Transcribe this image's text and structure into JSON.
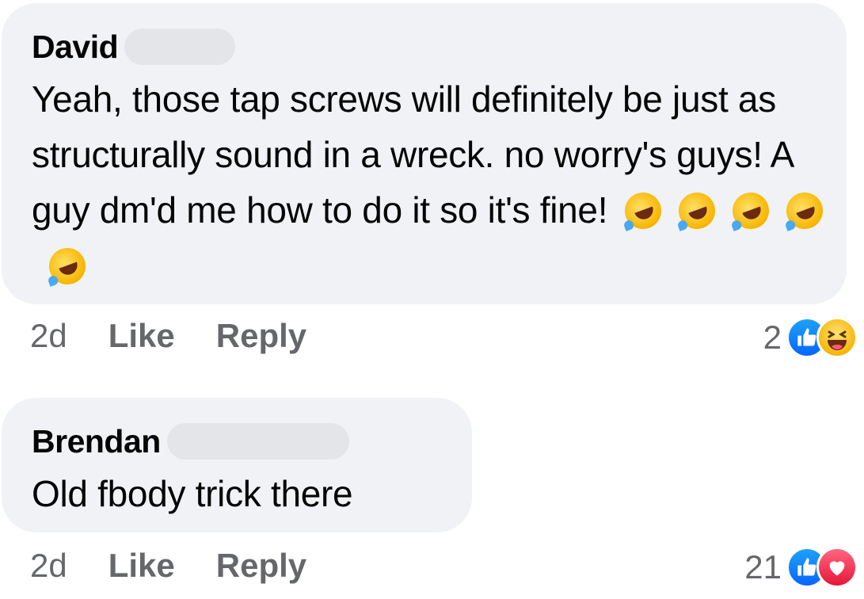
{
  "comments": [
    {
      "author": "David",
      "text": "Yeah, those tap screws will definitely be just as structurally sound in a wreck. no worry's guys! A guy dm'd me how to do it so it's fine!",
      "emojis": [
        "rofl-emoji",
        "rofl-emoji",
        "rofl-emoji",
        "rofl-emoji",
        "rofl-emoji"
      ],
      "time": "2d",
      "like_label": "Like",
      "reply_label": "Reply",
      "reaction_count": "2",
      "reactions": [
        "like-icon",
        "haha-icon"
      ]
    },
    {
      "author": "Brendan",
      "text": "Old fbody trick there",
      "emojis": [],
      "time": "2d",
      "like_label": "Like",
      "reply_label": "Reply",
      "reaction_count": "21",
      "reactions": [
        "like-icon",
        "love-icon"
      ]
    }
  ],
  "colors": {
    "bubble": "#f0f2f5",
    "meta_text": "#65676b",
    "like_blue": "#0866ff",
    "love_red": "#e61739"
  }
}
